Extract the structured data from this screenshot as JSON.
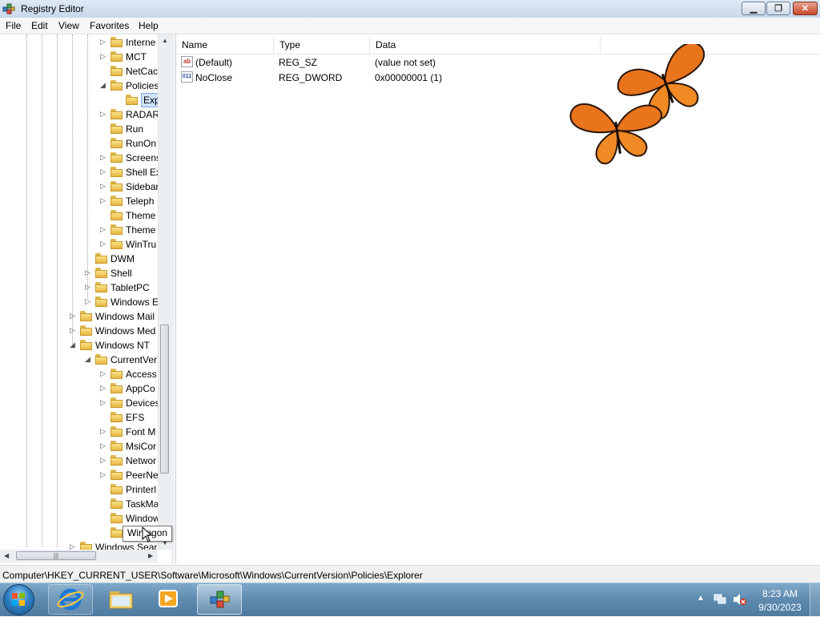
{
  "window": {
    "title": "Registry Editor"
  },
  "menu": [
    "File",
    "Edit",
    "View",
    "Favorites",
    "Help"
  ],
  "tree": [
    {
      "label": "Interne",
      "arrow": "▷"
    },
    {
      "label": "MCT",
      "arrow": "▷"
    },
    {
      "label": "NetCac",
      "arrow": ""
    },
    {
      "label": "Policies",
      "arrow": "◢"
    },
    {
      "label": "Exp",
      "arrow": "",
      "selected": true
    },
    {
      "label": "RADAR",
      "arrow": "▷"
    },
    {
      "label": "Run",
      "arrow": ""
    },
    {
      "label": "RunOn",
      "arrow": ""
    },
    {
      "label": "Screens",
      "arrow": "▷"
    },
    {
      "label": "Shell Ex",
      "arrow": "▷"
    },
    {
      "label": "Sidebar",
      "arrow": "▷"
    },
    {
      "label": "Teleph",
      "arrow": "▷"
    },
    {
      "label": "Theme",
      "arrow": ""
    },
    {
      "label": "Theme",
      "arrow": "▷"
    },
    {
      "label": "WinTru",
      "arrow": "▷"
    },
    {
      "label": "DWM",
      "arrow": ""
    },
    {
      "label": "Shell",
      "arrow": "▷"
    },
    {
      "label": "TabletPC",
      "arrow": "▷"
    },
    {
      "label": "Windows E",
      "arrow": "▷"
    },
    {
      "label": "Windows Mail",
      "arrow": "▷"
    },
    {
      "label": "Windows Med",
      "arrow": "▷"
    },
    {
      "label": "Windows NT",
      "arrow": "◢"
    },
    {
      "label": "CurrentVer",
      "arrow": "◢"
    },
    {
      "label": "Access",
      "arrow": "▷"
    },
    {
      "label": "AppCo",
      "arrow": "▷"
    },
    {
      "label": "Devices",
      "arrow": "▷"
    },
    {
      "label": "EFS",
      "arrow": ""
    },
    {
      "label": "Font M",
      "arrow": "▷"
    },
    {
      "label": "MsiCor",
      "arrow": "▷"
    },
    {
      "label": "Networ",
      "arrow": "▷"
    },
    {
      "label": "PeerNe",
      "arrow": "▷"
    },
    {
      "label": "Printerl",
      "arrow": ""
    },
    {
      "label": "TaskMa",
      "arrow": ""
    },
    {
      "label": "Window",
      "arrow": ""
    },
    {
      "label": "Winlogon",
      "arrow": ""
    },
    {
      "label": "Windows Sear",
      "arrow": "▷"
    }
  ],
  "list": {
    "columns": [
      "Name",
      "Type",
      "Data"
    ],
    "rows": [
      {
        "name": "(Default)",
        "type": "REG_SZ",
        "data": "(value not set)",
        "icon": "string-value-icon",
        "icon_text": "ab"
      },
      {
        "name": "NoClose",
        "type": "REG_DWORD",
        "data": "0x00000001 (1)",
        "icon": "binary-value-icon",
        "icon_text": "011"
      }
    ]
  },
  "status_path": "Computer\\HKEY_CURRENT_USER\\Software\\Microsoft\\Windows\\CurrentVersion\\Policies\\Explorer",
  "tooltip": "Winlogon",
  "clock": {
    "time": "8:23 AM",
    "date": "9/30/2023"
  },
  "taskbar": [
    "internet-explorer",
    "file-explorer",
    "media-player",
    "registry-editor"
  ]
}
